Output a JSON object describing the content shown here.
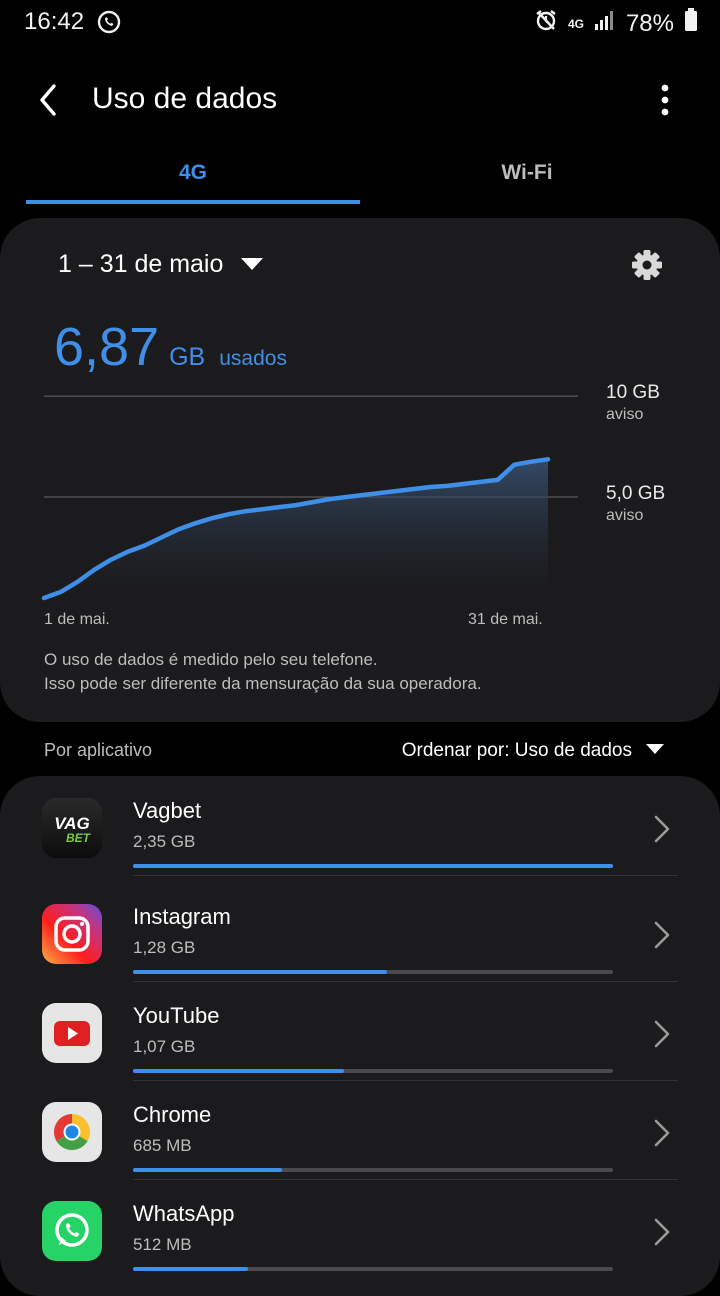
{
  "status": {
    "time": "16:42",
    "battery": "78%",
    "network": "4G"
  },
  "appbar": {
    "title": "Uso de dados"
  },
  "tabs": [
    {
      "label": "4G",
      "active": true
    },
    {
      "label": "Wi-Fi",
      "active": false
    }
  ],
  "summary": {
    "period": "1 – 31 de maio",
    "amount": "6,87",
    "unit": "GB",
    "used_label": "usados"
  },
  "chart_data": {
    "type": "area",
    "x": [
      "1",
      "2",
      "3",
      "4",
      "5",
      "6",
      "7",
      "8",
      "9",
      "10",
      "11",
      "12",
      "13",
      "14",
      "15",
      "16",
      "17",
      "18",
      "19",
      "20",
      "21",
      "22",
      "23",
      "24",
      "25",
      "26",
      "27",
      "28",
      "29",
      "30",
      "31"
    ],
    "values": [
      0.0,
      0.3,
      0.8,
      1.4,
      1.9,
      2.3,
      2.6,
      3.0,
      3.4,
      3.7,
      3.95,
      4.15,
      4.3,
      4.4,
      4.5,
      4.6,
      4.75,
      4.9,
      5.0,
      5.1,
      5.2,
      5.3,
      5.4,
      5.5,
      5.55,
      5.65,
      5.75,
      5.85,
      6.6,
      6.75,
      6.87
    ],
    "ylim": [
      0,
      10.5
    ],
    "gridlines": [
      {
        "value": 10,
        "label": "10 GB",
        "sub": "aviso"
      },
      {
        "value": 5,
        "label": "5,0 GB",
        "sub": "aviso"
      }
    ],
    "x_start_label": "1 de mai.",
    "x_end_label": "31 de mai.",
    "color": "#3f8ee8"
  },
  "note": {
    "line1": "O uso de dados é medido pelo seu telefone.",
    "line2": "Isso pode ser diferente da mensuração da sua operadora."
  },
  "list_header": {
    "left": "Por aplicativo",
    "sort": "Ordenar por: Uso de dados"
  },
  "apps": [
    {
      "name": "Vagbet",
      "size": "2,35 GB",
      "fraction": 1.0,
      "icon": "vagbet-icon",
      "logo_text": [
        "VAG",
        "BET"
      ]
    },
    {
      "name": "Instagram",
      "size": "1,28 GB",
      "fraction": 0.53,
      "icon": "instagram-icon"
    },
    {
      "name": "YouTube",
      "size": "1,07 GB",
      "fraction": 0.44,
      "icon": "youtube-icon"
    },
    {
      "name": "Chrome",
      "size": "685 MB",
      "fraction": 0.31,
      "icon": "chrome-icon"
    },
    {
      "name": "WhatsApp",
      "size": "512 MB",
      "fraction": 0.24,
      "icon": "whatsapp-icon"
    }
  ]
}
